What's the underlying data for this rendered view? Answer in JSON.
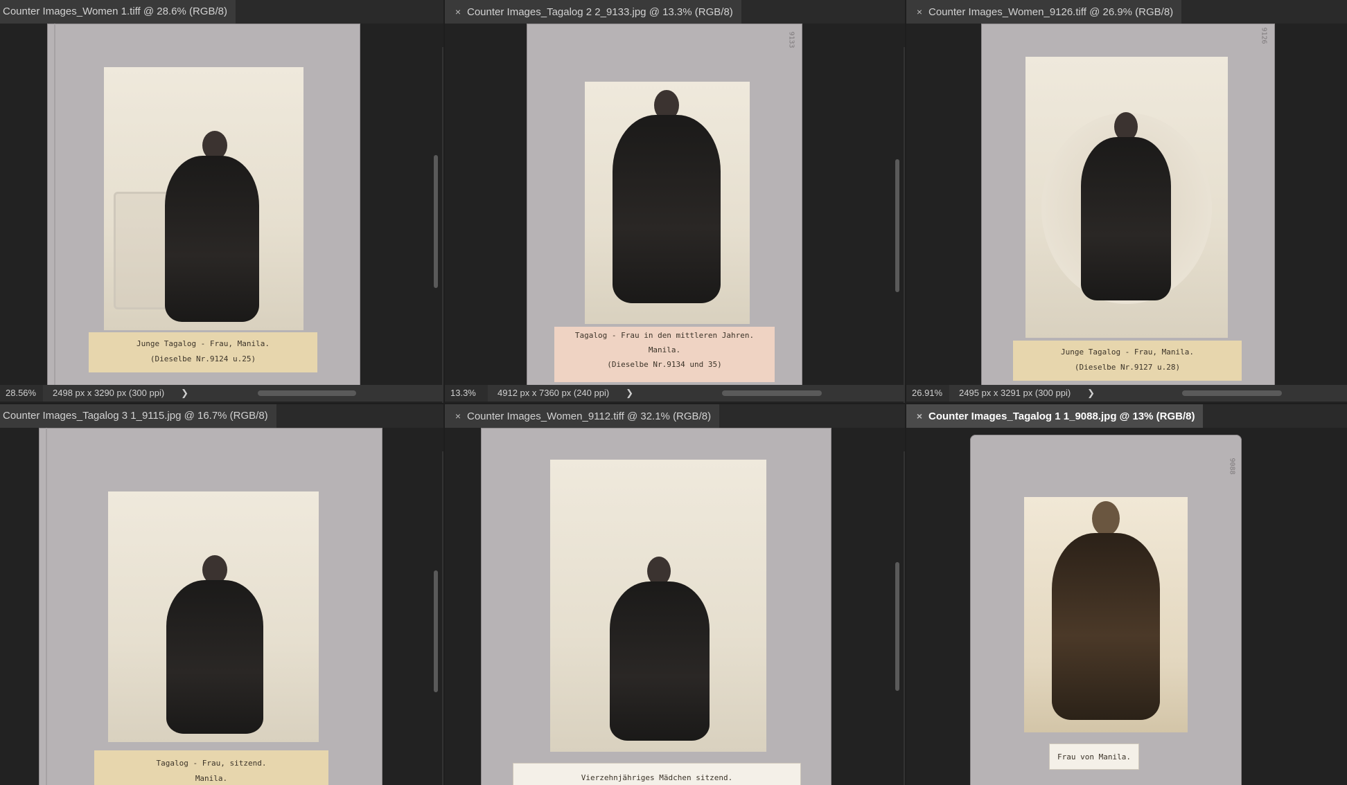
{
  "tabs": [
    {
      "title": "Counter Images_Women 1.tiff @ 28.6% (RGB/8)",
      "has_close": false,
      "active": false,
      "zoom": "28.56%",
      "dims": "2498 px x 3290 px (300 ppi)",
      "label_lines": [
        "Junge Tagalog - Frau, Manila.",
        "(Dieselbe Nr.9124 u.25)"
      ]
    },
    {
      "title": "Counter Images_Tagalog 2 2_9133.jpg @ 13.3% (RGB/8)",
      "has_close": true,
      "active": false,
      "zoom": "13.3%",
      "dims": "4912 px x 7360 px (240 ppi)",
      "label_lines": [
        "Tagalog - Frau in den mittleren Jahren.",
        "Manila.",
        "(Dieselbe Nr.9134 und 35)"
      ],
      "corner": "9133"
    },
    {
      "title": "Counter Images_Women_9126.tiff @ 26.9% (RGB/8)",
      "has_close": true,
      "active": false,
      "zoom": "26.91%",
      "dims": "2495 px x 3291 px (300 ppi)",
      "label_lines": [
        "Junge Tagalog - Frau, Manila.",
        "(Dieselbe Nr.9127 u.28)"
      ],
      "corner": "9126"
    },
    {
      "title": "Counter Images_Tagalog 3 1_9115.jpg @ 16.7% (RGB/8)",
      "has_close": false,
      "active": false,
      "label_lines": [
        "Tagalog - Frau, sitzend.",
        "Manila."
      ]
    },
    {
      "title": "Counter Images_Women_9112.tiff @ 32.1% (RGB/8)",
      "has_close": true,
      "active": false,
      "label_lines": [
        "Vierzehnjähriges Mädchen sitzend."
      ]
    },
    {
      "title": "Counter Images_Tagalog 1 1_9088.jpg @ 13% (RGB/8)",
      "has_close": true,
      "active": true,
      "label_lines": [
        "Frau von Manila."
      ],
      "corner": "9088"
    }
  ],
  "icons": {
    "close": "close-icon",
    "chevron": "chevron-right-icon"
  },
  "glyphs": {
    "close": "×",
    "chevron": "❯"
  }
}
